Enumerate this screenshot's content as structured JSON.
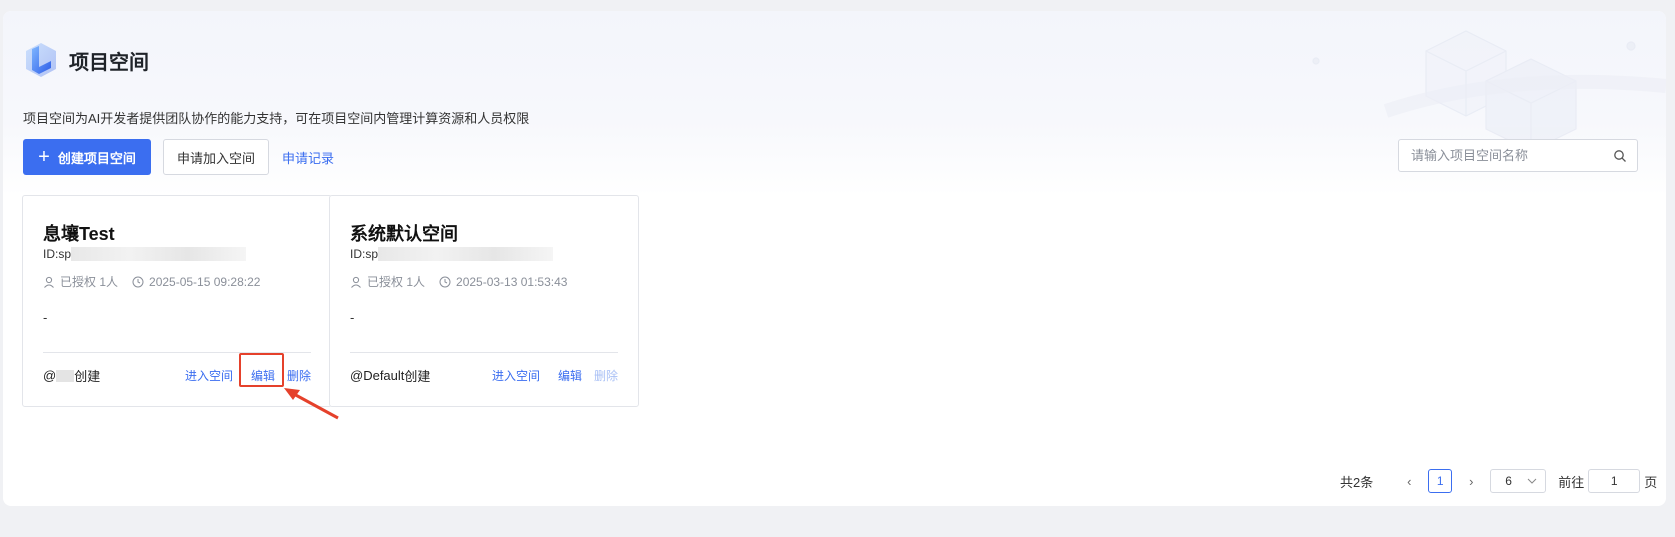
{
  "header": {
    "title": "项目空间",
    "description": "项目空间为AI开发者提供团队协作的能力支持，可在项目空间内管理计算资源和人员权限"
  },
  "toolbar": {
    "create_label": "创建项目空间",
    "join_label": "申请加入空间",
    "records_label": "申请记录"
  },
  "search": {
    "placeholder": "请输入项目空间名称",
    "value": ""
  },
  "cards": [
    {
      "name": "息壤Test",
      "id_prefix": "ID:sp",
      "authorized": "已授权 1人",
      "time": "2025-05-15 09:28:22",
      "description": "-",
      "creator_prefix": "@",
      "creator_suffix": "创建",
      "actions": {
        "enter": "进入空间",
        "edit": "编辑",
        "delete": "删除"
      }
    },
    {
      "name": "系统默认空间",
      "id_prefix": "ID:sp",
      "authorized": "已授权 1人",
      "time": "2025-03-13 01:53:43",
      "description": "-",
      "creator_prefix": "@Default",
      "creator_suffix": "创建",
      "actions": {
        "enter": "进入空间",
        "edit": "编辑",
        "delete": "删除"
      }
    }
  ],
  "pagination": {
    "total": "共2条",
    "current_page": "1",
    "page_size": "6",
    "goto_label": "前往",
    "goto_value": "1",
    "page_label": "页"
  },
  "colors": {
    "accent": "#3b6ef0",
    "highlight": "#e5412b"
  }
}
